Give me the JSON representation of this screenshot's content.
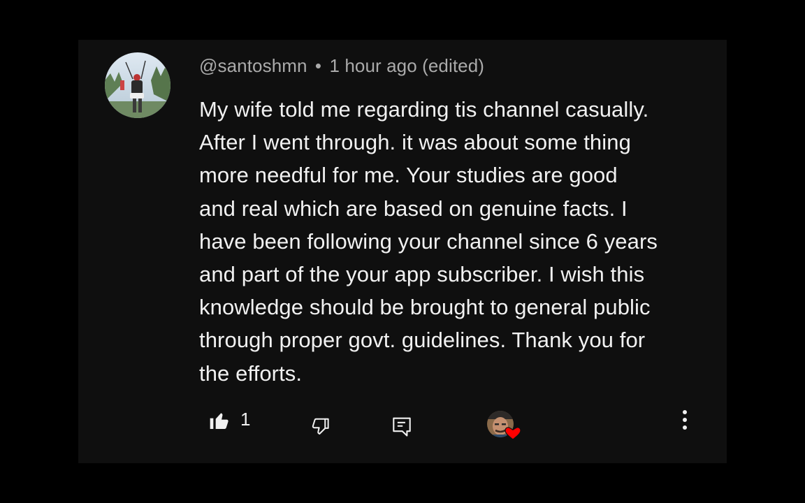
{
  "comment": {
    "author": "@santoshmn",
    "separator": "•",
    "timestamp": "1 hour ago",
    "edited_label": "(edited)",
    "text": "My wife told me regarding tis channel casually.\nAfter I went through. it was about  some thing\nmore needful  for me. Your studies are good\nand real which are based on genuine facts. I\nhave been following your channel since 6 years\nand part of the your app subscriber. I wish this\nknowledge should be brought to general public\nthrough proper govt. guidelines. Thank you for\nthe efforts."
  },
  "actions": {
    "like_count": "1",
    "like_icon": "thumb-up-filled-icon",
    "dislike_icon": "thumb-down-outline-icon",
    "reply_icon": "reply-comment-icon",
    "creator_heart_icon": "creator-heart-avatar",
    "more_icon": "more-vert-icon"
  },
  "colors": {
    "page_bg": "#000000",
    "card_bg": "#0f0f0f",
    "text_primary": "#f1f1f1",
    "text_secondary": "#aaaaaa",
    "heart": "#ff0000"
  }
}
